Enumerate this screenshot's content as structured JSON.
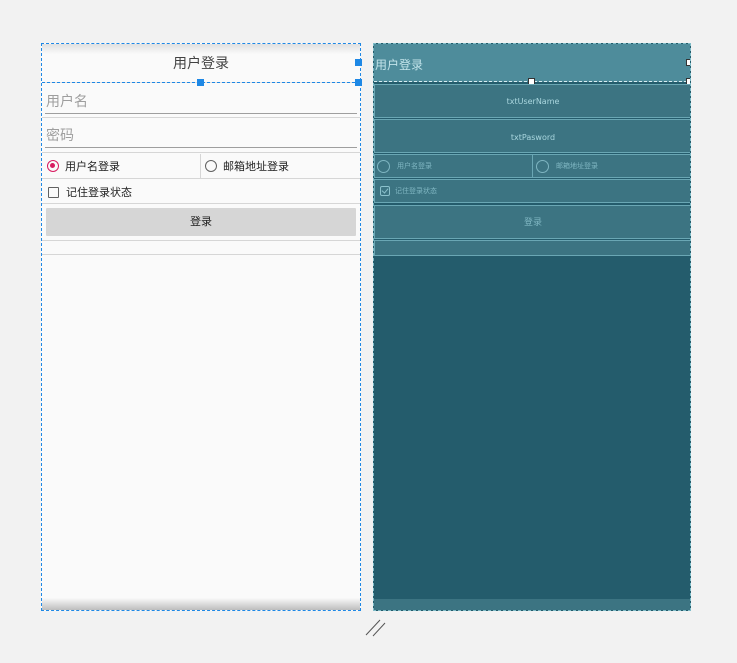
{
  "design": {
    "title": "用户登录",
    "username_placeholder": "用户名",
    "password_placeholder": "密码",
    "radio_username": "用户名登录",
    "radio_email": "邮箱地址登录",
    "remember_label": "记住登录状态",
    "login_button": "登录"
  },
  "blueprint": {
    "title": "用户登录",
    "username_id": "txtUserName",
    "password_id": "txtPasword",
    "radio_username": "用户名登录",
    "radio_email": "邮箱地址登录",
    "remember_label": "记住登录状态",
    "login_button": "登录"
  },
  "colors": {
    "selection": "#1e88e5",
    "radio_checked": "#d81b60",
    "blueprint_bg": "#245c6c"
  },
  "icons": {
    "resize_grip": "resize-grip-icon"
  }
}
